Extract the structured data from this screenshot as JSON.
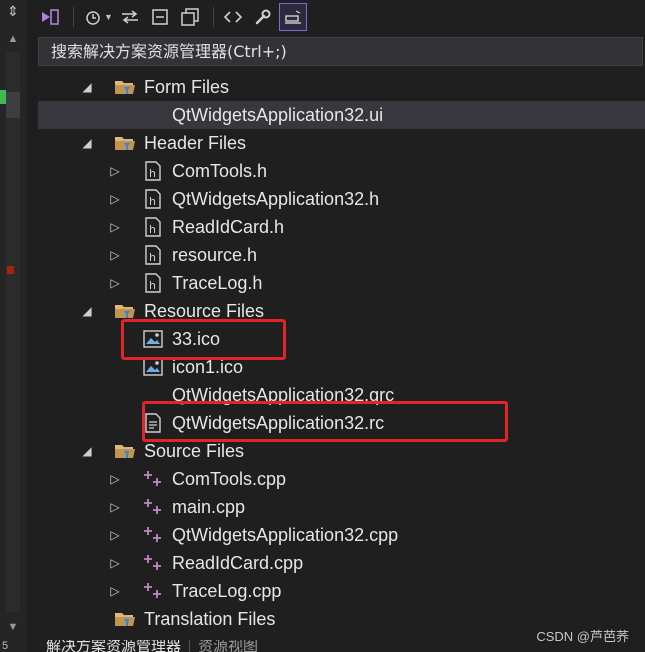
{
  "search": {
    "placeholder": "搜索解决方案资源管理器(Ctrl+;)"
  },
  "toolbar": {
    "buttons": [
      {
        "name": "vs-solution-icon",
        "glyph": "⧉"
      },
      {
        "name": "history-icon",
        "glyph": "◷"
      },
      {
        "name": "sync-icon",
        "glyph": "⇋"
      },
      {
        "name": "collapse-icon",
        "glyph": "⊟"
      },
      {
        "name": "copy-icon",
        "glyph": "❐"
      },
      {
        "name": "code-icon",
        "glyph": "<>"
      },
      {
        "name": "properties-wrench-icon",
        "glyph": "🔧"
      },
      {
        "name": "preview-icon",
        "glyph": "▭"
      }
    ]
  },
  "tree": [
    {
      "level": 1,
      "kind": "folder",
      "expander": "down",
      "label": "Form Files"
    },
    {
      "level": 2,
      "kind": "none",
      "expander": "",
      "label": "QtWidgetsApplication32.ui",
      "selected": true
    },
    {
      "level": 1,
      "kind": "folder",
      "expander": "down",
      "label": "Header Files"
    },
    {
      "level": 2,
      "kind": "header",
      "expander": "right",
      "label": "ComTools.h"
    },
    {
      "level": 2,
      "kind": "header",
      "expander": "right",
      "label": "QtWidgetsApplication32.h"
    },
    {
      "level": 2,
      "kind": "header",
      "expander": "right",
      "label": "ReadIdCard.h"
    },
    {
      "level": 2,
      "kind": "header",
      "expander": "right",
      "label": "resource.h"
    },
    {
      "level": 2,
      "kind": "header",
      "expander": "right",
      "label": "TraceLog.h"
    },
    {
      "level": 1,
      "kind": "folder",
      "expander": "down",
      "label": "Resource Files"
    },
    {
      "level": 2,
      "kind": "image",
      "expander": "",
      "label": "33.ico"
    },
    {
      "level": 2,
      "kind": "image",
      "expander": "",
      "label": "icon1.ico"
    },
    {
      "level": 2,
      "kind": "none",
      "expander": "",
      "label": "QtWidgetsApplication32.qrc"
    },
    {
      "level": 2,
      "kind": "rc",
      "expander": "",
      "label": "QtWidgetsApplication32.rc"
    },
    {
      "level": 1,
      "kind": "folder",
      "expander": "down",
      "label": "Source Files"
    },
    {
      "level": 2,
      "kind": "cpp",
      "expander": "right",
      "label": "ComTools.cpp"
    },
    {
      "level": 2,
      "kind": "cpp",
      "expander": "right",
      "label": "main.cpp"
    },
    {
      "level": 2,
      "kind": "cpp",
      "expander": "right",
      "label": "QtWidgetsApplication32.cpp"
    },
    {
      "level": 2,
      "kind": "cpp",
      "expander": "right",
      "label": "ReadIdCard.cpp"
    },
    {
      "level": 2,
      "kind": "cpp",
      "expander": "right",
      "label": "TraceLog.cpp"
    },
    {
      "level": 1,
      "kind": "folder",
      "expander": "",
      "label": "Translation Files"
    }
  ],
  "tabs": [
    {
      "label": "解决方案资源管理器",
      "active": true
    },
    {
      "label": "资源视图",
      "active": false
    }
  ],
  "watermark": "CSDN @芦芭荞",
  "gutter": {
    "bottom_number": "5"
  },
  "colors": {
    "highlight": "#e0242a",
    "folder": "#dcb67a",
    "cpp": "#c586c0",
    "selected_row": "#37373d"
  }
}
